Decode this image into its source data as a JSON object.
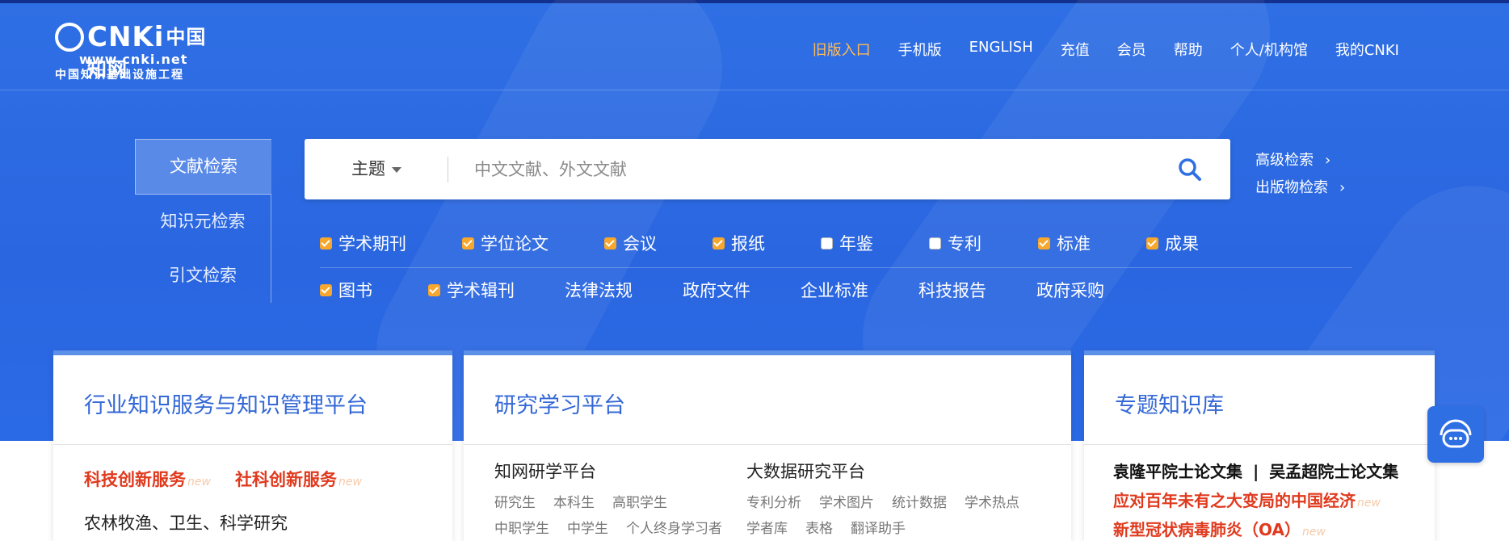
{
  "logo": {
    "brand": "CNKi",
    "cn_name": "中国知网",
    "url_text": "www.cnki.net",
    "slogan": "中国知识基础设施工程"
  },
  "nav": [
    {
      "label": "旧版入口",
      "highlight": true
    },
    {
      "label": "手机版"
    },
    {
      "label": "ENGLISH"
    },
    {
      "label": "充值"
    },
    {
      "label": "会员"
    },
    {
      "label": "帮助"
    },
    {
      "label": "个人/机构馆"
    },
    {
      "label": "我的CNKI"
    }
  ],
  "left_tabs": [
    "文献检索",
    "知识元检索",
    "引文检索"
  ],
  "search": {
    "field": "主题",
    "placeholder": "中文文献、外文文献"
  },
  "side_links": [
    "高级检索",
    "出版物检索"
  ],
  "checkbox_row1": [
    {
      "label": "学术期刊",
      "checked": true
    },
    {
      "label": "学位论文",
      "checked": true
    },
    {
      "label": "会议",
      "checked": true
    },
    {
      "label": "报纸",
      "checked": true
    },
    {
      "label": "年鉴",
      "checked": false
    },
    {
      "label": "专利",
      "checked": false
    },
    {
      "label": "标准",
      "checked": true
    },
    {
      "label": "成果",
      "checked": true
    }
  ],
  "checkbox_row2": [
    {
      "label": "图书",
      "checked": true
    },
    {
      "label": "学术辑刊",
      "checked": true
    }
  ],
  "plain_links_row2": [
    "法律法规",
    "政府文件",
    "企业标准",
    "科技报告",
    "政府采购"
  ],
  "cards": {
    "industry": {
      "title": "行业知识服务与知识管理平台",
      "red1": "科技创新服务",
      "red2": "社科创新服务",
      "new_tag": "new",
      "line": "农林牧渔、卫生、科学研究"
    },
    "research": {
      "title": "研究学习平台",
      "col1_title": "知网研学平台",
      "col1_row1": [
        "研究生",
        "本科生",
        "高职学生"
      ],
      "col1_row2": [
        "中职学生",
        "中学生",
        "个人终身学习者"
      ],
      "col2_title": "大数据研究平台",
      "col2_row1": [
        "专利分析",
        "学术图片",
        "统计数据",
        "学术热点"
      ],
      "col2_row2": [
        "学者库",
        "表格",
        "翻译助手"
      ]
    },
    "topic": {
      "title": "专题知识库",
      "line1a": "袁隆平院士论文集",
      "line1b": "吴孟超院士论文集",
      "red1": "应对百年未有之大变局的中国经济",
      "red2": "新型冠状病毒肺炎（OA）",
      "new_tag": "new"
    }
  },
  "colors": {
    "hero_blue": "#2f6fe4",
    "accent_orange": "#f7a72c",
    "highlight_red": "#e03a1e",
    "card_title_blue": "#3468d6"
  }
}
